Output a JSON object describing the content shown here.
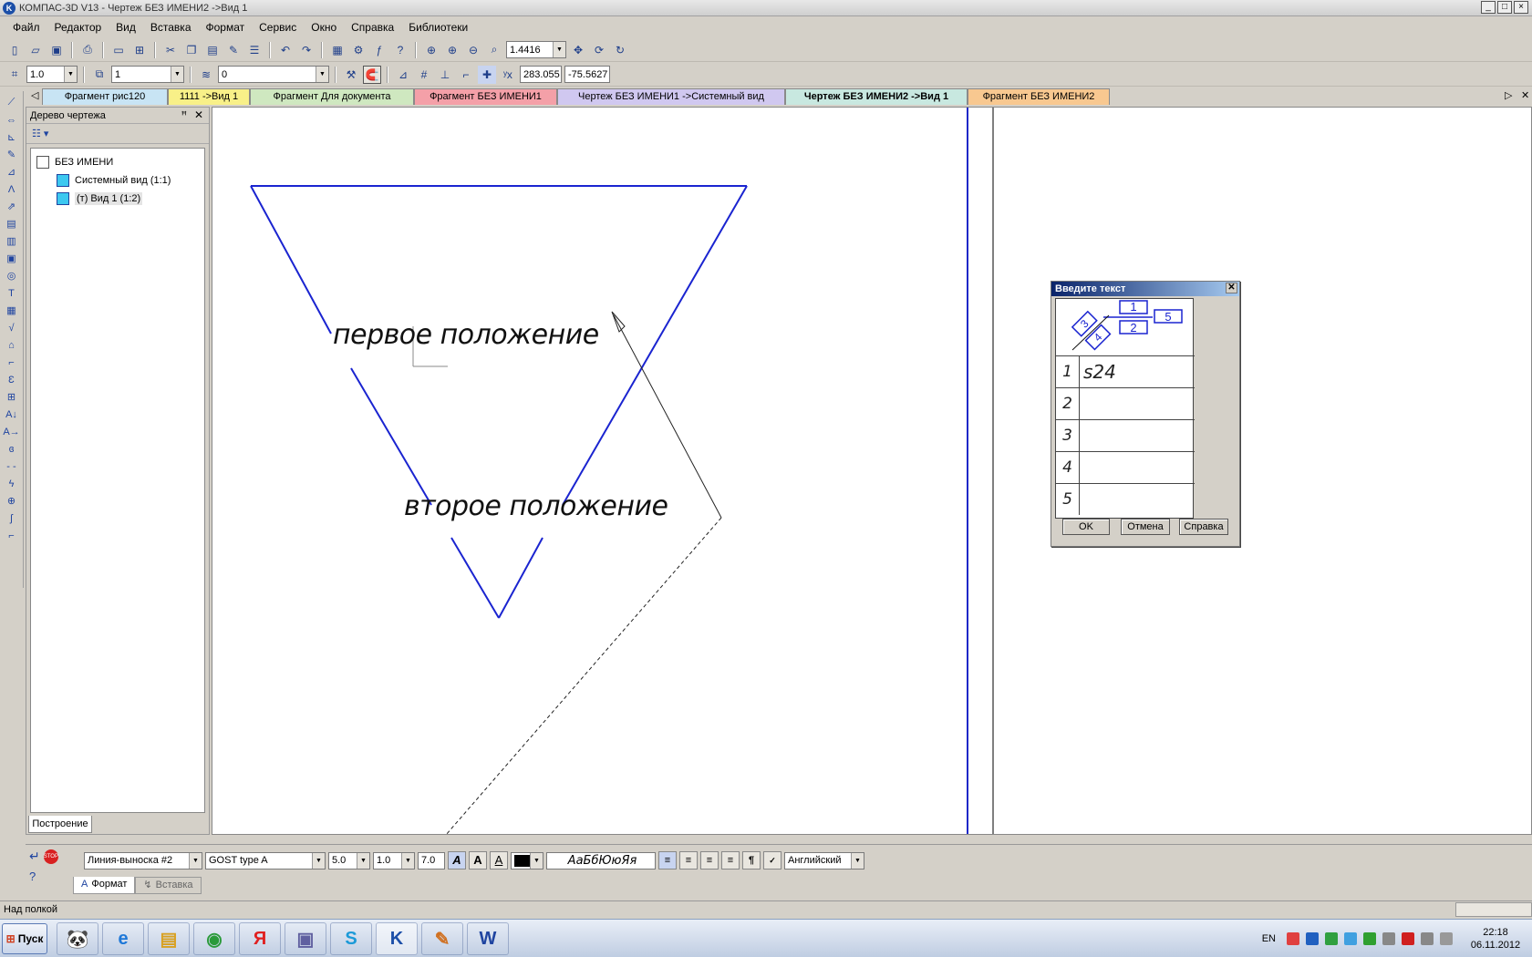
{
  "window": {
    "title": "КОМПАС-3D V13 - Чертеж БЕЗ ИМЕНИ2 ->Вид 1",
    "controls": [
      "_",
      "□",
      "×"
    ]
  },
  "menu": [
    "Файл",
    "Редактор",
    "Вид",
    "Вставка",
    "Формат",
    "Сервис",
    "Окно",
    "Справка",
    "Библиотеки"
  ],
  "toolbar_std": {
    "zoom_value": "1.4416"
  },
  "toolbar_current": {
    "step_value": "1.0",
    "view_value": "1",
    "layer_value": "0",
    "coord_x": "283.055",
    "coord_y": "-75.5627"
  },
  "tabs": [
    {
      "label": "Фрагмент рис120",
      "color": "#c8e4f4"
    },
    {
      "label": "1111 ->Вид 1",
      "color": "#f8f088"
    },
    {
      "label": "Фрагмент Для документа",
      "color": "#cfe8c0"
    },
    {
      "label": "Фрагмент БЕЗ ИМЕНИ1",
      "color": "#f4a0a8"
    },
    {
      "label": "Чертеж БЕЗ ИМЕНИ1 ->Системный вид",
      "color": "#d0c8f0"
    },
    {
      "label": "Чертеж БЕЗ ИМЕНИ2 ->Вид 1",
      "color": "#c8e8e0"
    },
    {
      "label": "Фрагмент БЕЗ ИМЕНИ2",
      "color": "#f8c890"
    }
  ],
  "tree_panel": {
    "title": "Дерево чертежа",
    "root": "БЕЗ ИМЕНИ",
    "items": [
      "Системный вид (1:1)",
      "(т) Вид 1 (1:2)"
    ],
    "bottom_tab": "Построение"
  },
  "canvas": {
    "label_first": "первое положение",
    "label_second": "второе положение"
  },
  "dialog": {
    "title": "Введите текст",
    "rows": [
      {
        "num": "1",
        "value": "s24"
      },
      {
        "num": "2",
        "value": ""
      },
      {
        "num": "3",
        "value": ""
      },
      {
        "num": "4",
        "value": ""
      },
      {
        "num": "5",
        "value": ""
      }
    ],
    "buttons": {
      "ok": "OK",
      "cancel": "Отмена",
      "help": "Справка"
    }
  },
  "props": {
    "style_value": "Линия-выноска #2",
    "font_value": "GOST type A",
    "height_value": "5.0",
    "narrow_value": "1.0",
    "step_value": "7.0",
    "sample_text": "АаБбЮюЯя",
    "language_value": "Английский",
    "tab_format": "Формат",
    "tab_insert": "Вставка"
  },
  "status": {
    "text": "Над полкой"
  },
  "taskbar": {
    "start_label": "Пуск",
    "lang": "EN",
    "time": "22:18",
    "date": "06.11.2012"
  }
}
